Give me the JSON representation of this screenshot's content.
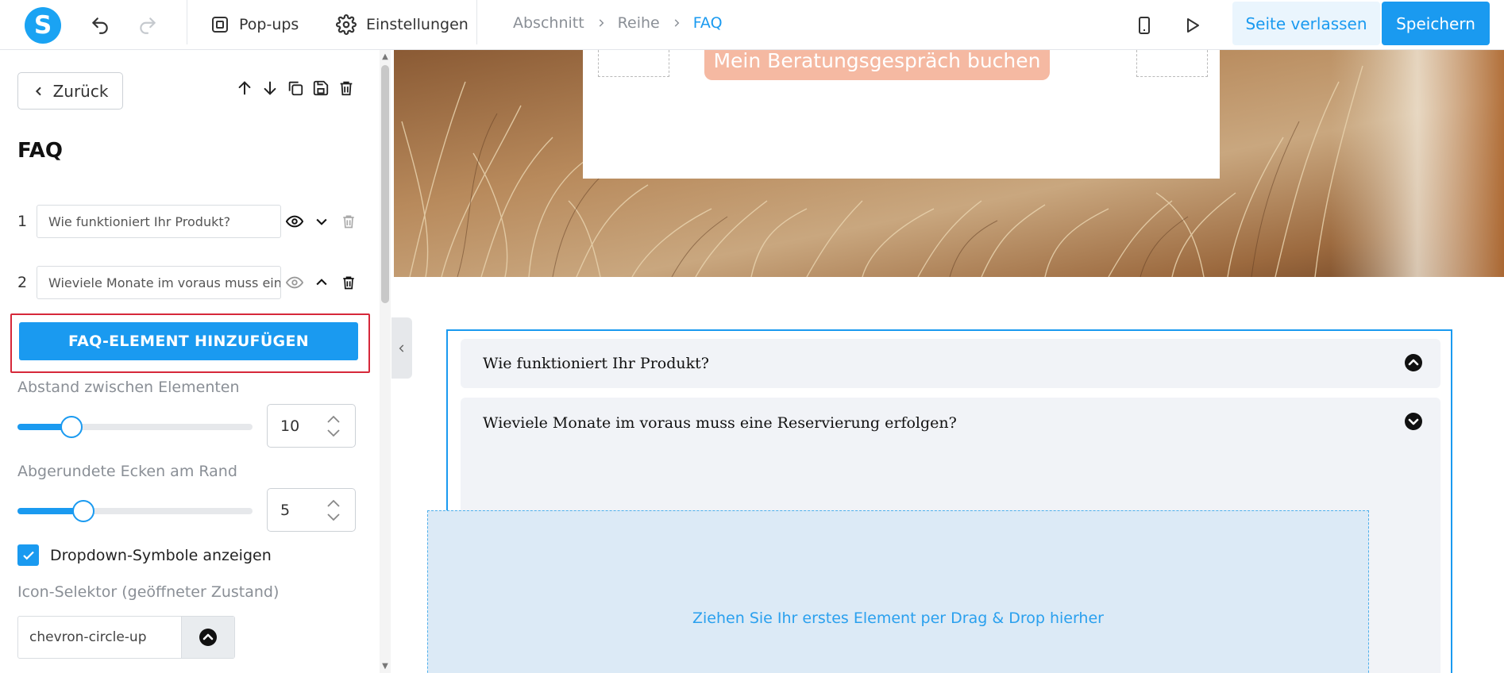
{
  "topbar": {
    "logo_letter": "S",
    "popups_label": "Pop-ups",
    "settings_label": "Einstellungen",
    "breadcrumb": [
      "Abschnitt",
      "Reihe",
      "FAQ"
    ],
    "leave_label": "Seite verlassen",
    "save_label": "Speichern"
  },
  "panel": {
    "back_label": "Zurück",
    "title": "FAQ",
    "items": [
      {
        "num": "1",
        "question": "Wie funktioniert Ihr Produkt?"
      },
      {
        "num": "2",
        "question": "Wieviele Monate im voraus muss eine Reservierung erfolgen?"
      }
    ],
    "add_label": "FAQ-ELEMENT HINZUFÜGEN",
    "spacing_label": "Abstand zwischen Elementen",
    "spacing_value": "10",
    "spacing_level": 0.23,
    "radius_label": "Abgerundete Ecken am Rand",
    "radius_value": "5",
    "radius_level": 0.28,
    "dropdown_label": "Dropdown-Symbole anzeigen",
    "dropdown_checked": true,
    "icon_selector_label": "Icon-Selektor (geöffneter Zustand)",
    "icon_selector_value": "chevron-circle-up"
  },
  "canvas": {
    "book_button": "Mein Beratungsgespräch buchen",
    "faq": [
      {
        "question": "Wie funktioniert Ihr Produkt?",
        "icon": "chevron-circle-up"
      },
      {
        "question": "Wieviele Monate im voraus muss eine Reservierung erfolgen?",
        "icon": "chevron-circle-down"
      }
    ],
    "dropzone_text": "Ziehen Sie Ihr erstes Element per Drag & Drop hierher"
  },
  "colors": {
    "accent": "#1a9af0",
    "highlight": "#d6283a",
    "book_button": "#f5b9a2"
  }
}
